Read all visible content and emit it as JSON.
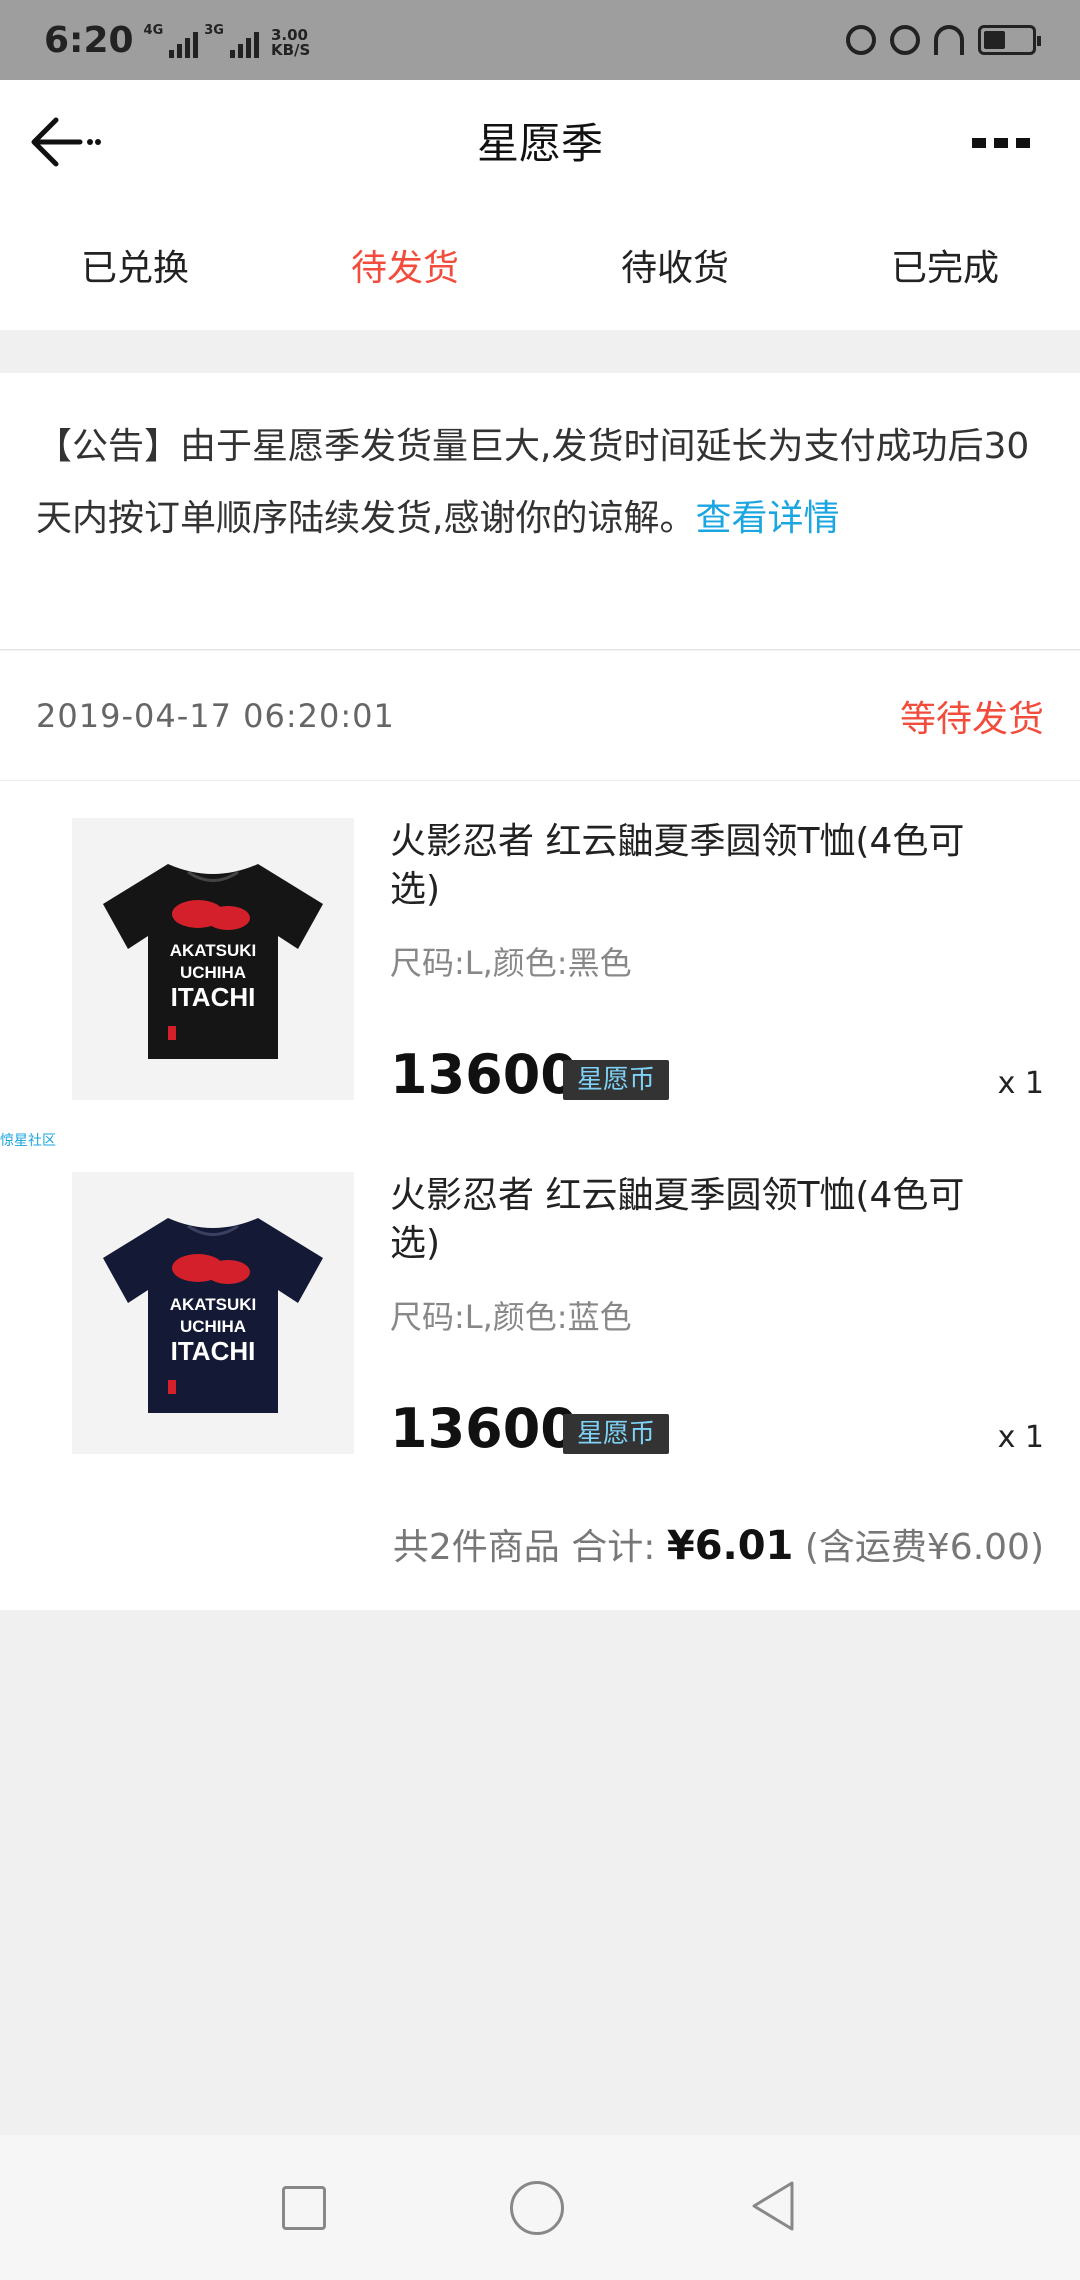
{
  "status_bar": {
    "time": "6:20",
    "net1": "4G",
    "net2": "3G",
    "speed_value": "3.00",
    "speed_unit": "KB/S",
    "icons": [
      "lock-rotation-icon",
      "alarm-icon",
      "headphones-icon",
      "battery-icon"
    ]
  },
  "header": {
    "title": "星愿季",
    "back_icon": "arrow-left-icon",
    "more_icon": "more-icon"
  },
  "tabs": [
    {
      "label": "已兑换",
      "active": false
    },
    {
      "label": "待发货",
      "active": true
    },
    {
      "label": "待收货",
      "active": false
    },
    {
      "label": "已完成",
      "active": false
    }
  ],
  "notice": {
    "text": "【公告】由于星愿季发货量巨大,发货时间延长为支付成功后30天内按订单顺序陆续发货,感谢你的谅解。",
    "link": "查看详情"
  },
  "order": {
    "time": "2019-04-17 06:20:01",
    "status": "等待发货",
    "items": [
      {
        "title": "火影忍者 红云鼬夏季圆领T恤(4色可选)",
        "spec": "尺码:L,颜色:黑色",
        "price": "13600",
        "currency": "星愿币",
        "qty": "x 1",
        "shirt_color": "#151515"
      },
      {
        "title": "火影忍者 红云鼬夏季圆领T恤(4色可选)",
        "spec": "尺码:L,颜色:蓝色",
        "price": "13600",
        "currency": "星愿币",
        "qty": "x 1",
        "shirt_color": "#141a35"
      }
    ],
    "watermark": "惊星社区",
    "total": {
      "count_text": "共2件商品",
      "label": "合计:",
      "amount": "¥6.01",
      "shipping": "(含运费¥6.00)"
    }
  },
  "colors": {
    "accent_red": "#f24c3d",
    "link_blue": "#1aa6e0",
    "badge_bg": "#333333",
    "badge_text": "#7fd3f7"
  },
  "shirt_print": {
    "line1": "AKATSUKI",
    "line2": "UCHIHA",
    "line3": "ITACHI"
  }
}
